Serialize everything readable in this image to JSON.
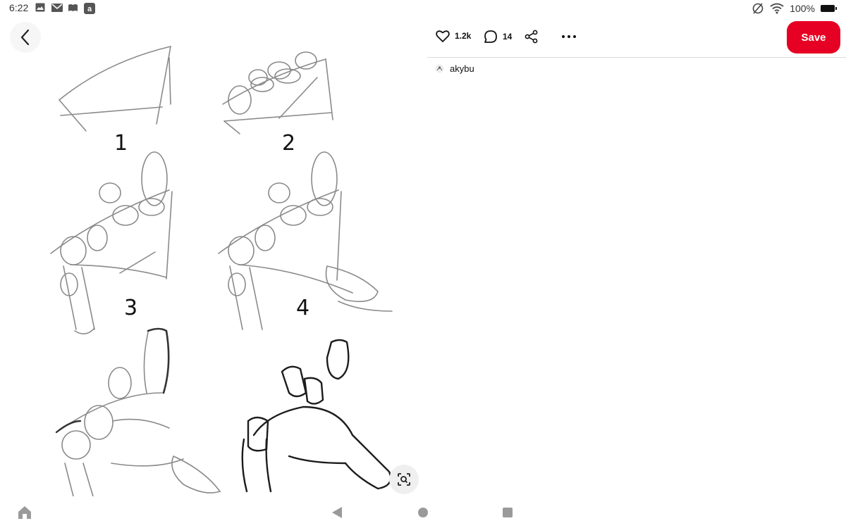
{
  "status_bar": {
    "time": "6:22",
    "battery_text": "100%",
    "left_icons": [
      "gallery-icon",
      "mail-icon",
      "app-icon",
      "amazon-icon"
    ],
    "right_icons": [
      "no-sim-icon",
      "wifi-icon",
      "battery-icon"
    ]
  },
  "pin": {
    "step_labels": [
      "1",
      "2",
      "3",
      "4"
    ]
  },
  "actions": {
    "likes": "1.2k",
    "comments": "14",
    "save_label": "Save"
  },
  "author": {
    "name": "akybu"
  },
  "colors": {
    "accent": "#e60023"
  }
}
